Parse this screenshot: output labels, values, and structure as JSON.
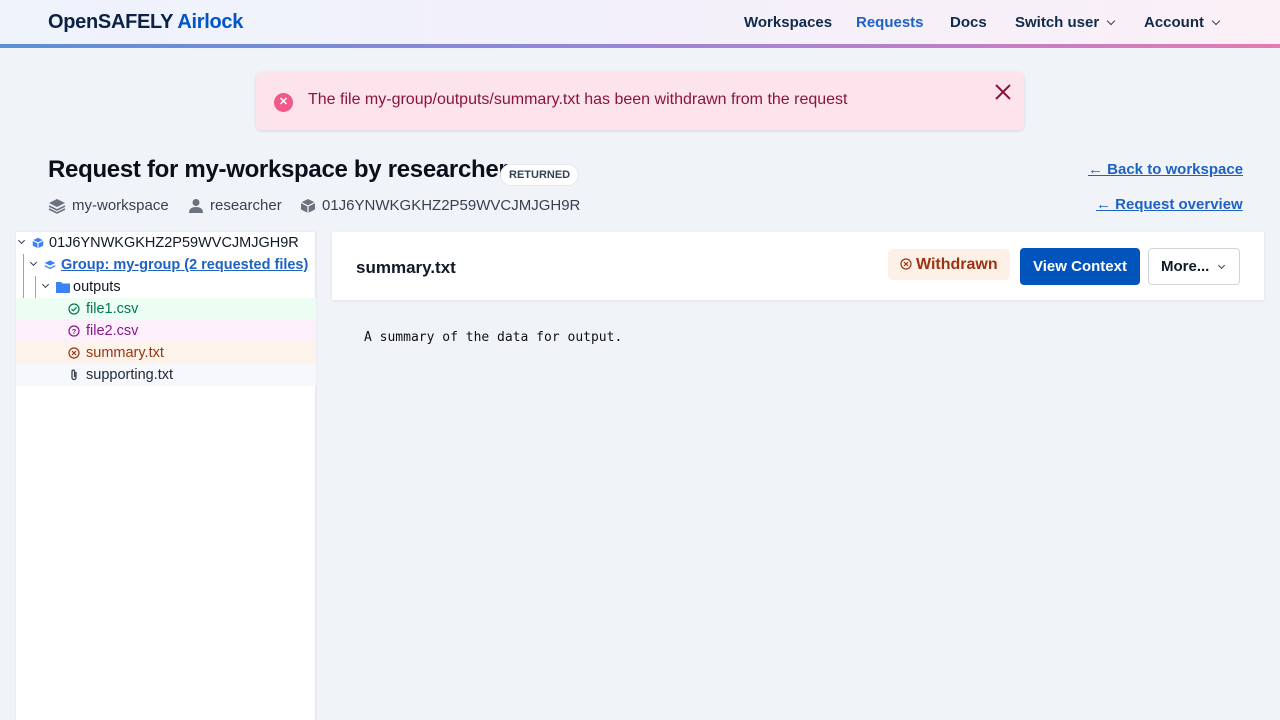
{
  "header": {
    "brand_primary": "OpenSAFELY",
    "brand_secondary": "Airlock",
    "nav": [
      {
        "label": "Workspaces",
        "active": false
      },
      {
        "label": "Requests",
        "active": true
      },
      {
        "label": "Docs",
        "active": false
      },
      {
        "label": "Switch user",
        "dropdown": true
      },
      {
        "label": "Account",
        "dropdown": true
      }
    ]
  },
  "toast": {
    "icon": "error-circle-icon",
    "message": "The file my-group/outputs/summary.txt has been withdrawn from the request",
    "close_glyph": "✕"
  },
  "request": {
    "title": "Request for my-workspace by researcher",
    "status_badge": "RETURNED",
    "meta": {
      "workspace": "my-workspace",
      "author": "researcher",
      "request_id": "01J6YNWKGKHZ2P59WVCJMJGH9R"
    },
    "links": {
      "back_to_workspace": "← Back to workspace",
      "request_overview": "← Request overview"
    }
  },
  "tree": {
    "root": "01J6YNWKGKHZ2P59WVCJMJGH9R",
    "group": "Group: my-group (2 requested files)",
    "folder": "outputs",
    "files": [
      {
        "name": "file1.csv",
        "state": "approved",
        "icon": "check-circle-icon",
        "color": "#047857",
        "bg": "#ecfdf3"
      },
      {
        "name": "file2.csv",
        "state": "pending",
        "icon": "question-circle-icon",
        "color": "#86198f",
        "bg": "#fdf0fb"
      },
      {
        "name": "summary.txt",
        "state": "withdrawn",
        "icon": "x-circle-icon",
        "color": "#9a3412",
        "bg": "#fdf3ea"
      },
      {
        "name": "supporting.txt",
        "state": "supporting",
        "icon": "paperclip-icon",
        "color": "#1f2937",
        "bg": "#f6f8fb"
      }
    ]
  },
  "file_panel": {
    "filename": "summary.txt",
    "status": "Withdrawn",
    "view_context": "View Context",
    "more": "More...",
    "contents": "A summary of the data for output."
  },
  "colors": {
    "accent": "#0054bc",
    "link": "#1d62c4",
    "withdrawn": "#9a3412"
  }
}
